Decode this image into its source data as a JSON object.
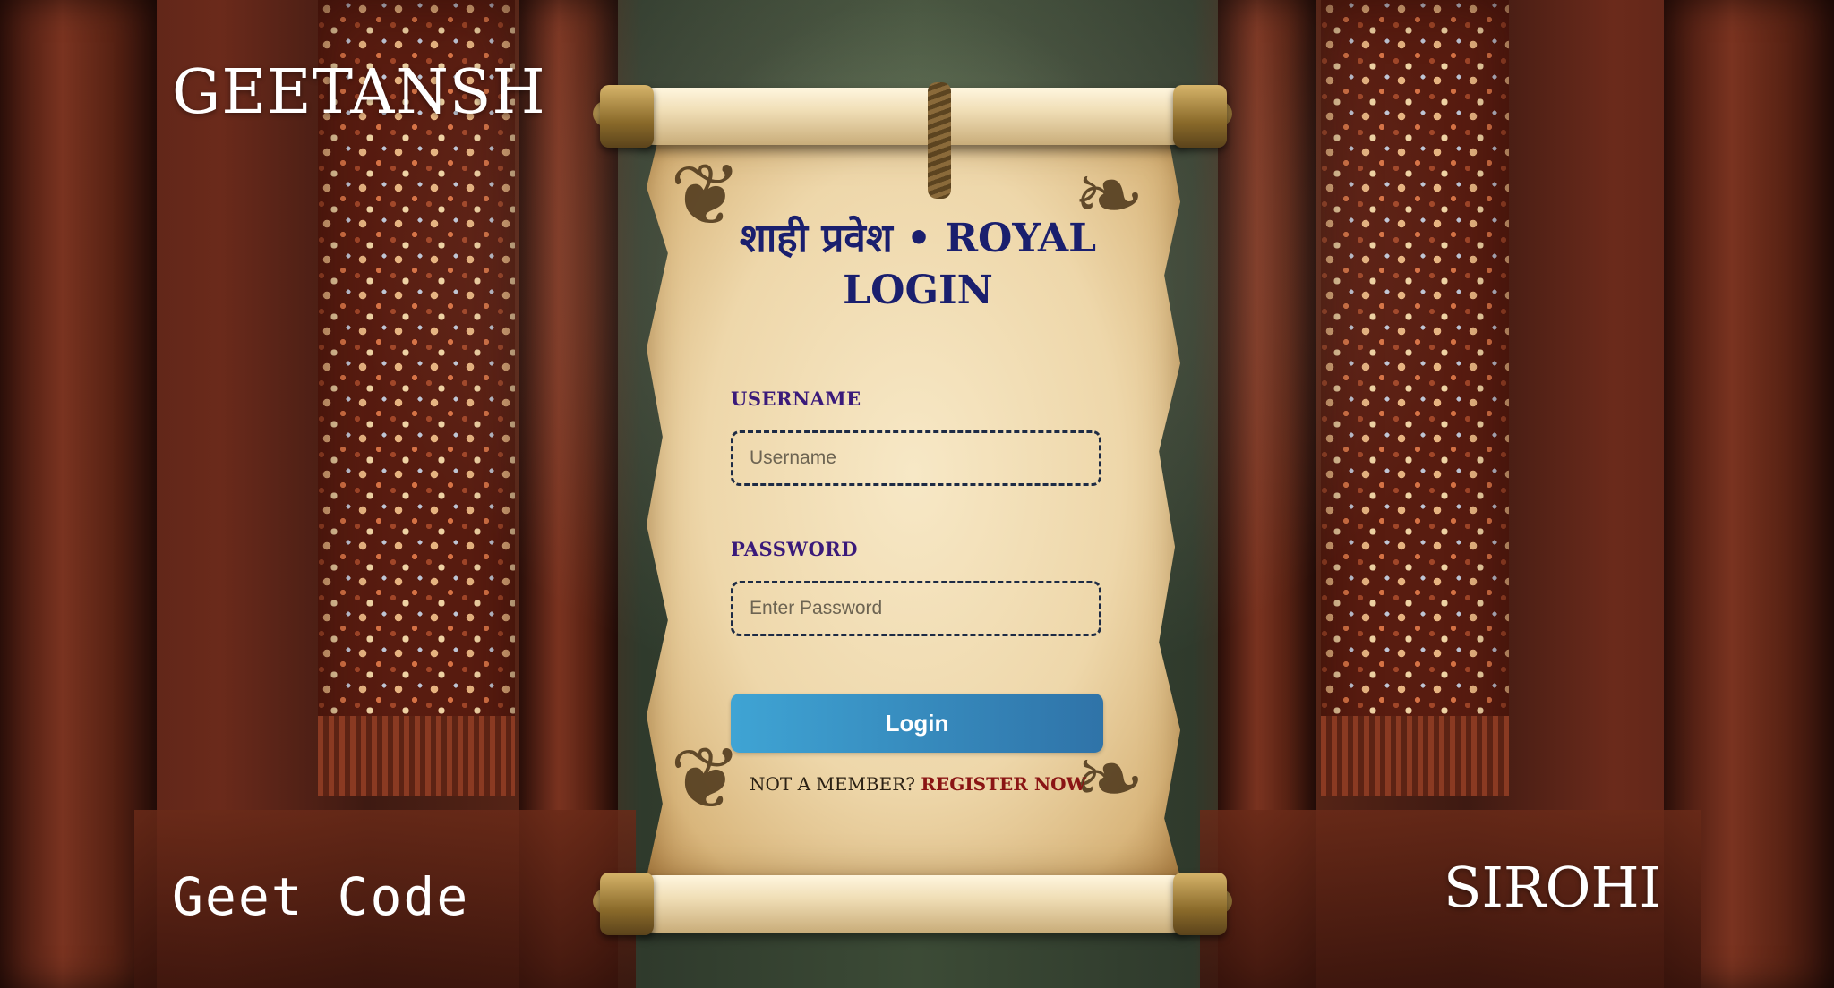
{
  "brand": {
    "top_left": "GEETANSH",
    "bottom_left": "Geet Code",
    "bottom_right": "SIROHI"
  },
  "login": {
    "title": "शाही प्रवेश • ROYAL LOGIN",
    "username_label": "USERNAME",
    "username_placeholder": "Username",
    "username_value": "",
    "password_label": "PASSWORD",
    "password_placeholder": "Enter Password",
    "password_value": "",
    "login_button": "Login",
    "not_member_text": "NOT A MEMBER?",
    "register_link": "REGISTER NOW"
  },
  "colors": {
    "title": "#1a1f6e",
    "labels": "#3a1a7a",
    "button_gradient_start": "#3fa4d4",
    "button_gradient_end": "#2f73a8",
    "register_link": "#8a1414"
  }
}
